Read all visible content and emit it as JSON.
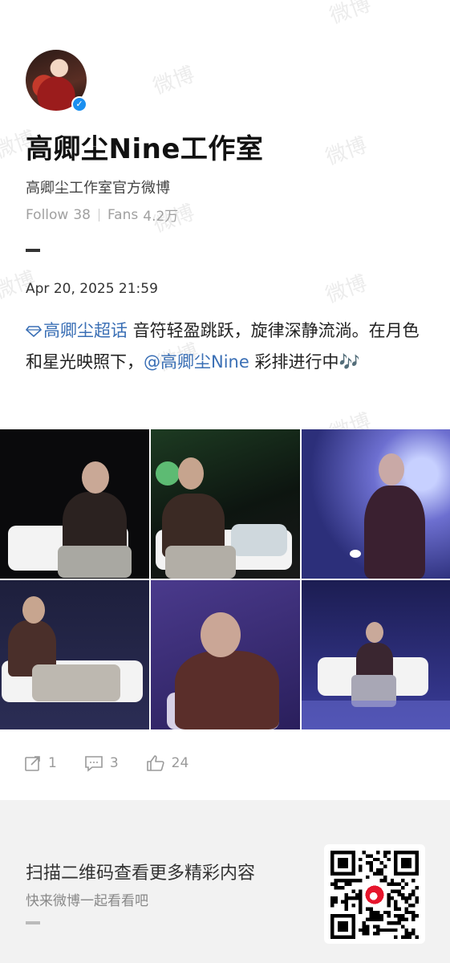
{
  "profile": {
    "name": "高卿尘Nine工作室",
    "bio": "高卿尘工作室官方微博",
    "follow_label": "Follow",
    "follow_count": "38",
    "fans_label": "Fans",
    "fans_count": "4.2万",
    "verified_icon": "check-icon"
  },
  "post": {
    "date": "Apr 20, 2025 21:59",
    "topic": "高卿尘超话",
    "text1": " 音符轻盈跳跃，旋律深静流淌。在月色和星光映照下，",
    "mention": "@高卿尘Nine",
    "text2": " 彩排进行中🎶"
  },
  "photos": [
    {
      "name": "photo-1",
      "bg": "#0a0a0c"
    },
    {
      "name": "photo-2",
      "bg": "#16221a"
    },
    {
      "name": "photo-3",
      "bg": "#3c3f8e"
    },
    {
      "name": "photo-4",
      "bg": "#232544"
    },
    {
      "name": "photo-5",
      "bg": "#3b2a74"
    },
    {
      "name": "photo-6",
      "bg": "#2c2d6e"
    }
  ],
  "actions": {
    "repost_count": "1",
    "comment_count": "3",
    "like_count": "24"
  },
  "footer": {
    "scan_title": "扫描二维码查看更多精彩内容",
    "scan_subtitle": "快来微博一起看看吧"
  },
  "watermark": "微博",
  "colors": {
    "link": "#3a6fb5",
    "verified": "#1b8ff0",
    "footer_bg": "#f2f2f2"
  }
}
